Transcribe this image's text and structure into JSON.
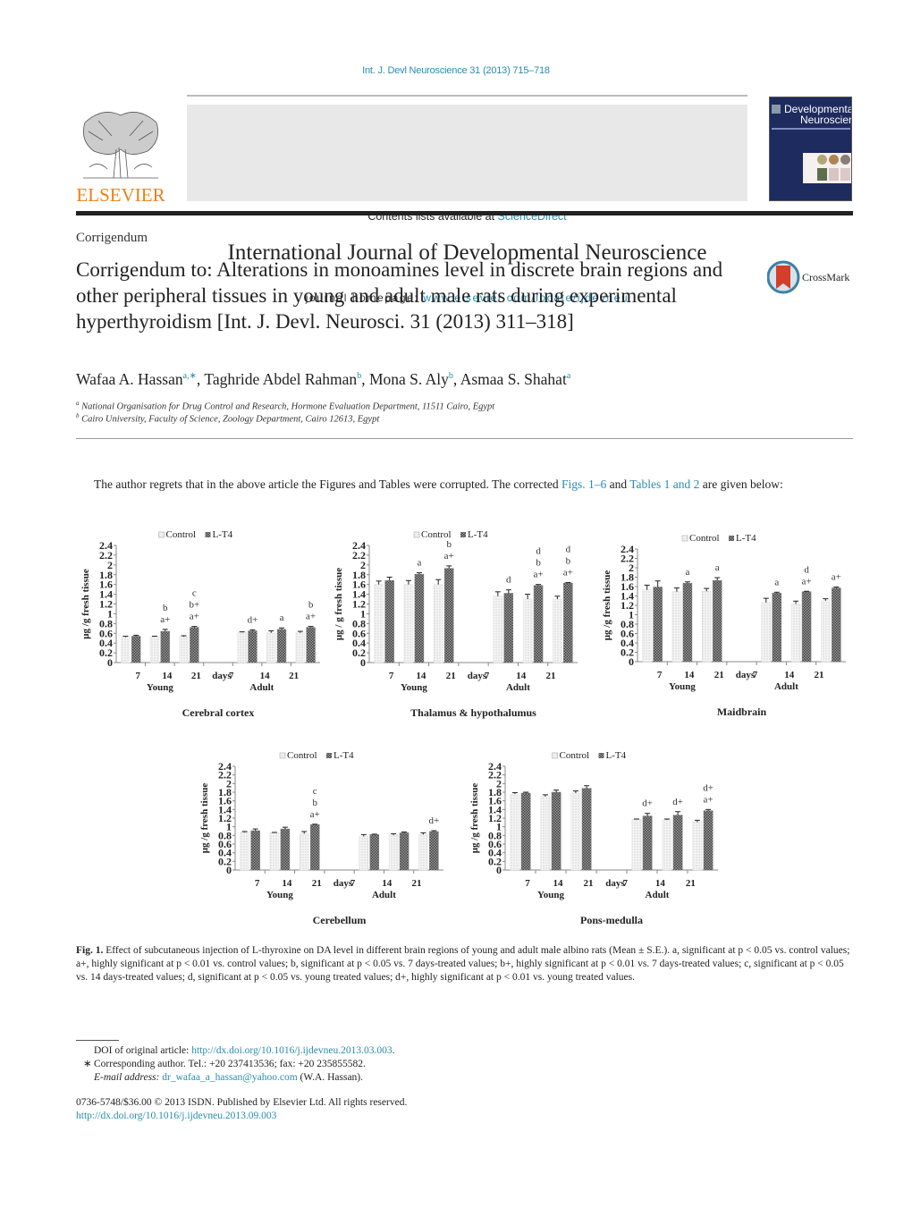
{
  "header": {
    "running_head": "Int. J. Devl Neuroscience 31 (2013) 715–718",
    "publisher_logo": "ELSEVIER",
    "contents_prefix": "Contents lists available at ",
    "contents_link": "ScienceDirect",
    "journal_title": "International Journal of Developmental Neuroscience",
    "homepage_prefix": "journal homepage: ",
    "homepage_link": "www.elsevier.com/locate/ijdevneu",
    "cover_title_1": "Developmental",
    "cover_title_2": "Neuroscience"
  },
  "article": {
    "section": "Corrigendum",
    "title": "Corrigendum to: Alterations in monoamines level in discrete brain regions and other peripheral tissues in young and adult male rats during experimental hyperthyroidism [Int. J. Devl. Neurosci. 31 (2013) 311–318]",
    "crossmark_label": "CrossMark",
    "authors": [
      {
        "name": "Wafaa A. Hassan",
        "sup": "a,∗"
      },
      {
        "name": "Taghride Abdel Rahman",
        "sup": "b"
      },
      {
        "name": "Mona S. Aly",
        "sup": "b"
      },
      {
        "name": "Asmaa S. Shahat",
        "sup": "a"
      }
    ],
    "affiliations": [
      {
        "key": "a",
        "text": "National Organisation for Drug Control and Research, Hormone Evaluation Department, 11511 Cairo, Egypt"
      },
      {
        "key": "b",
        "text": "Cairo University, Faculty of Science, Zoology Department, Cairo 12613, Egypt"
      }
    ],
    "body_pre": "The author regrets that in the above article the Figures and Tables were corrupted. The corrected ",
    "body_link1": "Figs. 1–6",
    "body_mid": " and ",
    "body_link2": "Tables 1 and 2",
    "body_post": " are given below:"
  },
  "chart_data": [
    {
      "type": "bar",
      "title": "Cerebral cortex",
      "ylabel": "μg /g fresh tissue",
      "ylim": [
        0,
        2.4
      ],
      "yticks": [
        "0",
        "0.2",
        "0.4",
        "0.6",
        "0.8",
        "1",
        "1.2",
        "1.4",
        "1.6",
        "1.8",
        "2",
        "2.2",
        "2.4"
      ],
      "legend": [
        "Control",
        "L-T4"
      ],
      "legend_position": "top",
      "groups": [
        {
          "label": "Young",
          "days": [
            "7",
            "14",
            "21"
          ]
        },
        {
          "label": "Adult",
          "days": [
            "7",
            "14",
            "21"
          ]
        }
      ],
      "days_label": "days",
      "series": [
        {
          "name": "Control",
          "values": [
            0.52,
            0.53,
            0.53,
            0.62,
            0.61,
            0.61
          ],
          "errors": [
            0.02,
            0.01,
            0.02,
            0.01,
            0.04,
            0.03
          ]
        },
        {
          "name": "L-T4",
          "values": [
            0.54,
            0.64,
            0.72,
            0.65,
            0.68,
            0.72
          ],
          "errors": [
            0.02,
            0.04,
            0.02,
            0.02,
            0.03,
            0.02
          ]
        }
      ],
      "annotations": [
        [],
        [
          "b",
          "a+"
        ],
        [
          "c",
          "b+",
          "a+"
        ],
        [
          "d+"
        ],
        [
          "a"
        ],
        [
          "b",
          "a+"
        ]
      ]
    },
    {
      "type": "bar",
      "title": "Thalamus & hypothalumus",
      "ylabel": "μg / g fresh tissue",
      "ylim": [
        0,
        2.4
      ],
      "yticks": [
        "0",
        "0.2",
        "0.4",
        "0.6",
        "0.8",
        "1",
        "1.2",
        "1.4",
        "1.6",
        "1.8",
        "2",
        "2.2",
        "2.4"
      ],
      "legend": [
        "Control",
        "L-T4"
      ],
      "legend_position": "top",
      "groups": [
        {
          "label": "Young",
          "days": [
            "7",
            "14",
            "21"
          ]
        },
        {
          "label": "Adult",
          "days": [
            "7",
            "14",
            "21"
          ]
        }
      ],
      "days_label": "days",
      "series": [
        {
          "name": "Control",
          "values": [
            1.6,
            1.6,
            1.6,
            1.36,
            1.3,
            1.3
          ],
          "errors": [
            0.07,
            0.08,
            0.1,
            0.09,
            0.1,
            0.06
          ]
        },
        {
          "name": "L-T4",
          "values": [
            1.68,
            1.81,
            1.93,
            1.42,
            1.58,
            1.63
          ],
          "errors": [
            0.07,
            0.03,
            0.05,
            0.07,
            0.02,
            0.01
          ]
        }
      ],
      "annotations": [
        [],
        [
          "a"
        ],
        [
          "b",
          "a+"
        ],
        [
          "d"
        ],
        [
          "d",
          "b",
          "a+"
        ],
        [
          "d",
          "b",
          "a+"
        ]
      ]
    },
    {
      "type": "bar",
      "title": "Maidbrain",
      "ylabel": "μg /g fresh tissue",
      "ylim": [
        0,
        2.4
      ],
      "yticks": [
        "0",
        "0.2",
        "0.4",
        "0.6",
        "0.8",
        "1",
        "1.2",
        "1.4",
        "1.6",
        "1.8",
        "2",
        "2.2",
        "2.4"
      ],
      "legend": [
        "Control",
        "L-T4"
      ],
      "legend_position": "top",
      "groups": [
        {
          "label": "Young",
          "days": [
            "7",
            "14",
            "21"
          ]
        },
        {
          "label": "Adult",
          "days": [
            "7",
            "14",
            "21"
          ]
        }
      ],
      "days_label": "days",
      "series": [
        {
          "name": "Control",
          "values": [
            1.53,
            1.49,
            1.5,
            1.26,
            1.23,
            1.3
          ],
          "errors": [
            0.1,
            0.08,
            0.06,
            0.09,
            0.06,
            0.04
          ]
        },
        {
          "name": "L-T4",
          "values": [
            1.59,
            1.67,
            1.73,
            1.46,
            1.49,
            1.57
          ],
          "errors": [
            0.13,
            0.03,
            0.06,
            0.02,
            0.01,
            0.02
          ]
        }
      ],
      "annotations": [
        [],
        [
          "a"
        ],
        [
          "a"
        ],
        [
          "a"
        ],
        [
          "d",
          "a+"
        ],
        [
          "a+"
        ]
      ]
    },
    {
      "type": "bar",
      "title": "Cerebellum",
      "ylabel": "μg /g fresh tissue",
      "ylim": [
        0,
        2.4
      ],
      "yticks": [
        "0",
        "0.2",
        "0.4",
        "0.6",
        "0.8",
        "1",
        "1.2",
        "1.4",
        "1.6",
        "1.8",
        "2",
        "2.2",
        "2.4"
      ],
      "legend": [
        "Control",
        "L-T4"
      ],
      "legend_position": "top",
      "groups": [
        {
          "label": "Young",
          "days": [
            "7",
            "14",
            "21"
          ]
        },
        {
          "label": "Adult",
          "days": [
            "7",
            "14",
            "21"
          ]
        }
      ],
      "days_label": "days",
      "series": [
        {
          "name": "Control",
          "values": [
            0.87,
            0.86,
            0.84,
            0.78,
            0.81,
            0.82
          ],
          "errors": [
            0.02,
            0.01,
            0.05,
            0.04,
            0.03,
            0.04
          ]
        },
        {
          "name": "L-T4",
          "values": [
            0.91,
            0.95,
            1.05,
            0.82,
            0.86,
            0.89
          ],
          "errors": [
            0.04,
            0.04,
            0.01,
            0.01,
            0.02,
            0.02
          ]
        }
      ],
      "annotations": [
        [],
        [],
        [
          "c",
          "b",
          "a+"
        ],
        [],
        [],
        [
          "d+"
        ]
      ]
    },
    {
      "type": "bar",
      "title": "Pons-medulla",
      "ylabel": "μg /g fresh tissue",
      "ylim": [
        0,
        2.4
      ],
      "yticks": [
        "0",
        "0.2",
        "0.4",
        "0.6",
        "0.8",
        "1",
        "1.2",
        "1.4",
        "1.6",
        "1.8",
        "2",
        "2.2",
        "2.4"
      ],
      "legend": [
        "Control",
        "L-T4"
      ],
      "legend_position": "top",
      "groups": [
        {
          "label": "Young",
          "days": [
            "7",
            "14",
            "21"
          ]
        },
        {
          "label": "Adult",
          "days": [
            "7",
            "14",
            "21"
          ]
        }
      ],
      "days_label": "days",
      "series": [
        {
          "name": "Control",
          "values": [
            1.76,
            1.7,
            1.78,
            1.17,
            1.16,
            1.11
          ],
          "errors": [
            0.03,
            0.04,
            0.05,
            0.01,
            0.02,
            0.04
          ]
        },
        {
          "name": "L-T4",
          "values": [
            1.78,
            1.8,
            1.89,
            1.25,
            1.27,
            1.37
          ],
          "errors": [
            0.02,
            0.05,
            0.06,
            0.06,
            0.08,
            0.03
          ]
        }
      ],
      "annotations": [
        [],
        [],
        [],
        [
          "d+"
        ],
        [
          "d+"
        ],
        [
          "d+",
          "a+"
        ]
      ]
    }
  ],
  "caption": {
    "label": "Fig. 1.",
    "text": " Effect of subcutaneous injection of L-thyroxine on DA level in different brain regions of young and adult male albino rats (Mean ± S.E.). a, significant at p < 0.05 vs. control values; a+, highly significant at p < 0.01 vs. control values; b, significant at p < 0.05 vs. 7 days-treated values; b+, highly significant at p < 0.01 vs. 7 days-treated values; c, significant at p < 0.05 vs. 14 days-treated values; d, significant at p < 0.05 vs. young treated values; d+, highly significant at p < 0.01 vs. young treated values."
  },
  "footnotes": {
    "doi_prefix": "DOI of original article: ",
    "doi_link": "http://dx.doi.org/10.1016/j.ijdevneu.2013.03.003",
    "doi_suffix": ".",
    "star": "∗",
    "corresponding": "Corresponding author. Tel.: +20 237413536; fax: +20 235855582.",
    "email_label": "E-mail address: ",
    "email_link": "dr_wafaa_a_hassan@yahoo.com",
    "email_suffix": " (W.A. Hassan).",
    "issn": "0736-5748/$36.00 © 2013 ISDN. Published by Elsevier Ltd. All rights reserved.",
    "article_doi": "http://dx.doi.org/10.1016/j.ijdevneu.2013.09.003"
  }
}
